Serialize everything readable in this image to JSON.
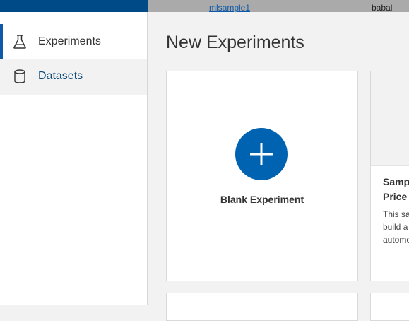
{
  "topbar": {
    "workspace": "mlsample1",
    "user": "babal"
  },
  "sidebar": {
    "items": [
      {
        "label": "Experiments",
        "icon": "flask-icon",
        "active": true
      },
      {
        "label": "Datasets",
        "icon": "cylinder-database-icon",
        "active": false
      }
    ]
  },
  "main": {
    "title": "New Experiments",
    "cards": [
      {
        "label": "Blank Experiment",
        "icon": "plus-icon"
      },
      {
        "title": "Samp\nPrice",
        "description": "This sa\nbuild a\nautome"
      }
    ]
  },
  "colors": {
    "brand_dark": "#004a87",
    "accent": "#0063b1",
    "link": "#0f5aa8"
  }
}
